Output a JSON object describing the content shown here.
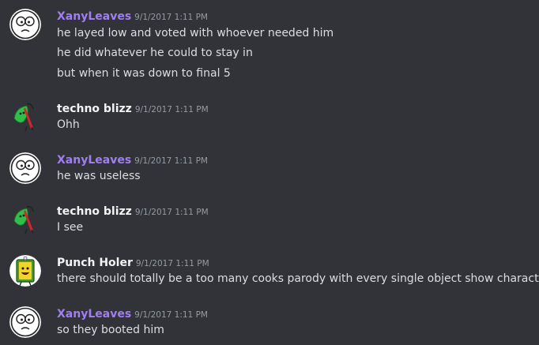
{
  "colors": {
    "background": "#313338",
    "xany_name": "#a07ff1",
    "default_name": "#f2f3f5",
    "timestamp": "#949ba4",
    "message_text": "#dbdee1"
  },
  "messages": [
    {
      "author": "XanyLeaves",
      "timestamp": "9/1/2017 1:11 PM",
      "avatar_icon": "scared-face-avatar-icon",
      "lines": [
        "he layed low and voted with whoever needed him",
        "he did whatever he could to stay in",
        "but when it was down to final 5"
      ]
    },
    {
      "author": "techno blizz",
      "timestamp": "9/1/2017 1:11 PM",
      "avatar_icon": "green-leaf-character-avatar-icon",
      "lines": [
        "Ohh"
      ]
    },
    {
      "author": "XanyLeaves",
      "timestamp": "9/1/2017 1:11 PM",
      "avatar_icon": "scared-face-avatar-icon",
      "lines": [
        "he was useless"
      ]
    },
    {
      "author": "techno blizz",
      "timestamp": "9/1/2017 1:11 PM",
      "avatar_icon": "green-leaf-character-avatar-icon",
      "lines": [
        "I see"
      ]
    },
    {
      "author": "Punch Holer",
      "timestamp": "9/1/2017 1:11 PM",
      "avatar_icon": "green-card-character-avatar-icon",
      "lines": [
        "there should totally be a too many cooks parody with every single object show character"
      ]
    },
    {
      "author": "XanyLeaves",
      "timestamp": "9/1/2017 1:11 PM",
      "avatar_icon": "scared-face-avatar-icon",
      "lines": [
        "so they booted him"
      ]
    }
  ]
}
